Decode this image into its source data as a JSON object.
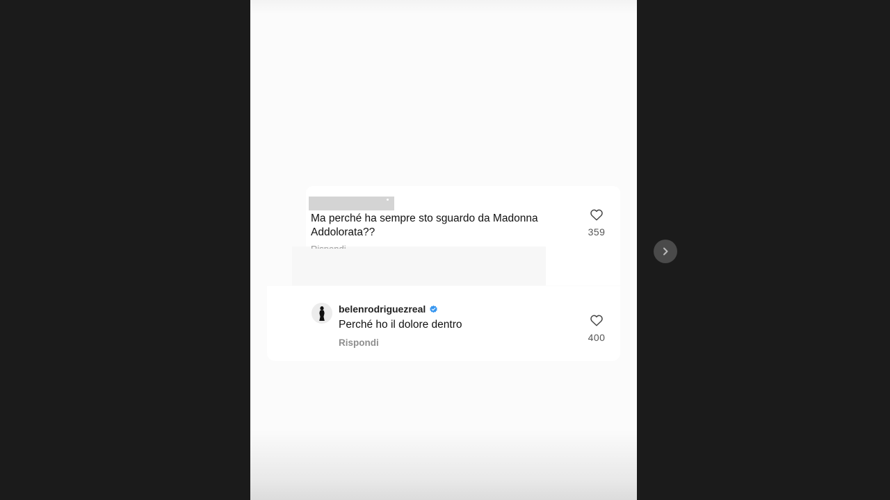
{
  "comment": {
    "text": "Ma perché ha sempre sto sguardo da Madonna Addolorata??",
    "likes": "359"
  },
  "reply": {
    "username": "belenrodriguezreal",
    "verified": true,
    "text": "Perché ho il dolore dentro",
    "likes": "400",
    "action_label": "Rispondi"
  },
  "colors": {
    "background": "#1b1b1b",
    "card": "#ffffff",
    "verified_badge": "#3897f0",
    "secondary_text": "#8e8e8e"
  },
  "icons": {
    "like": "heart-outline-icon",
    "next": "chevron-right-icon",
    "verified": "verified-badge-icon"
  }
}
